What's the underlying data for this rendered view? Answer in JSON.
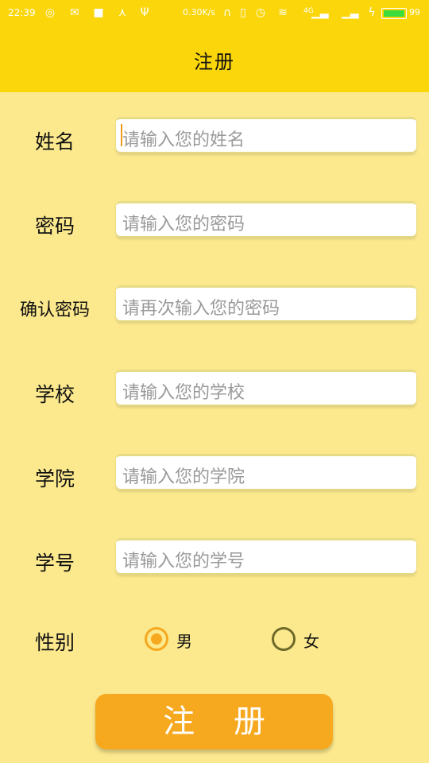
{
  "status_bar": {
    "time": "22:39",
    "network_speed": "0.30K/s",
    "signal": "4G",
    "battery_percent": "99",
    "battery_level": 0.99
  },
  "app_bar": {
    "title": "注册"
  },
  "form": {
    "name": {
      "label": "姓名",
      "placeholder": "请输入您的姓名"
    },
    "password": {
      "label": "密码",
      "placeholder": "请输入您的密码"
    },
    "confirm": {
      "label": "确认密码",
      "placeholder": "请再次输入您的密码"
    },
    "school": {
      "label": "学校",
      "placeholder": "请输入您的学校"
    },
    "college": {
      "label": "学院",
      "placeholder": "请输入您的学院"
    },
    "student_id": {
      "label": "学号",
      "placeholder": "请输入您的学号"
    },
    "gender": {
      "label": "性别",
      "options": [
        {
          "label": "男",
          "selected": true
        },
        {
          "label": "女",
          "selected": false
        }
      ]
    }
  },
  "submit_label": "注 册",
  "colors": {
    "accent": "#F6A81E",
    "header": "#FAD60A",
    "background": "#FCE98E"
  }
}
